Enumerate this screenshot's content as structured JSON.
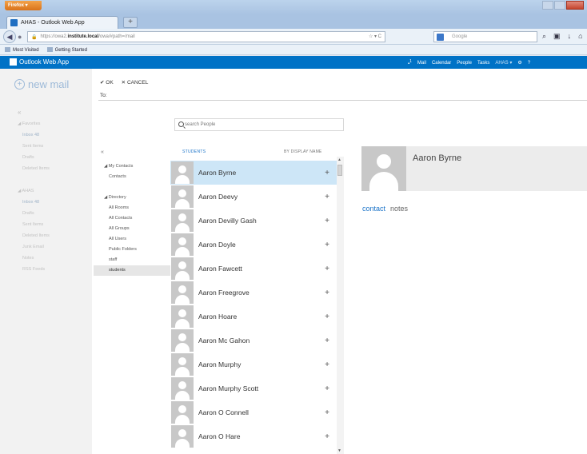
{
  "browser": {
    "app_button": "Firefox",
    "tab_title": "AHAS - Outlook Web App",
    "url_prefix": "https://owa2.",
    "url_host": "institute.local",
    "url_path": "/owa/#path=/mail",
    "search_placeholder": "Google",
    "bookmarks": [
      "Most Visited",
      "Getting Started"
    ]
  },
  "suitebar": {
    "brand": "Outlook Web App",
    "notification_count": "1",
    "links": [
      "Mail",
      "Calendar",
      "People",
      "Tasks"
    ],
    "user": "AHAS"
  },
  "leftnav": {
    "new_mail": "new mail",
    "favorites": {
      "header": "Favorites",
      "items": [
        "Inbox  48",
        "Sent Items",
        "Drafts",
        "Deleted Items"
      ]
    },
    "account": {
      "header": "AHAS",
      "items": [
        "Inbox  48",
        "Drafts",
        "Sent Items",
        "Deleted Items",
        "Junk Email",
        "Notes",
        "RSS Feeds"
      ]
    }
  },
  "compose": {
    "ok": "OK",
    "cancel": "CANCEL",
    "to_label": "To:"
  },
  "people_picker": {
    "search_placeholder": "search People",
    "list_header": "STUDENTS",
    "sort_label": "BY DISPLAY NAME",
    "tree": {
      "my_contacts": "My Contacts",
      "contacts": "Contacts",
      "directory": "Directory",
      "directory_items": [
        "All Rooms",
        "All Contacts",
        "All Groups",
        "All Users",
        "Public Folders",
        "staff",
        "students"
      ]
    },
    "people": [
      "Aaron Byrne",
      "Aaron Deevy",
      "Aaron Devilly Gash",
      "Aaron Doyle",
      "Aaron Fawcett",
      "Aaron Freegrove",
      "Aaron Hoare",
      "Aaron Mc Gahon",
      "Aaron Murphy",
      "Aaron Murphy Scott",
      "Aaron O Connell",
      "Aaron O Hare"
    ],
    "selected_index": 0
  },
  "contact_card": {
    "name": "Aaron Byrne",
    "tabs": [
      "contact",
      "notes"
    ]
  },
  "colors": {
    "suite_blue": "#0072c6",
    "selection": "#cde6f7",
    "link_blue": "#1a73c8"
  }
}
